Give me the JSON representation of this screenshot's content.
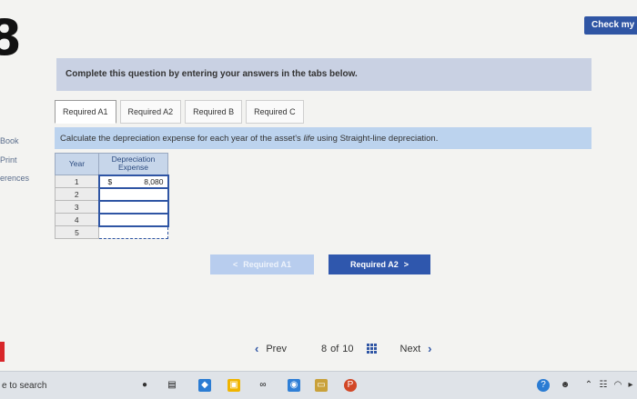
{
  "header": {
    "check_label": "Check my",
    "question_number": "8"
  },
  "sidebar": {
    "items": [
      "Book",
      "Print",
      "erences"
    ]
  },
  "banner": {
    "text": "Complete this question by entering your answers in the tabs below."
  },
  "tabs": [
    {
      "label": "Required A1",
      "active": true
    },
    {
      "label": "Required A2",
      "active": false
    },
    {
      "label": "Required B",
      "active": false
    },
    {
      "label": "Required C",
      "active": false
    }
  ],
  "instruction": {
    "pre": "Calculate the depreciation expense for each year of the asset's ",
    "italic": "life",
    "post": " using Straight-line depreciation."
  },
  "table": {
    "col_year": "Year",
    "col_expense": "Depreciation Expense",
    "rows": [
      {
        "year": "1",
        "currency": "$",
        "value": "8,080"
      },
      {
        "year": "2",
        "currency": "",
        "value": ""
      },
      {
        "year": "3",
        "currency": "",
        "value": ""
      },
      {
        "year": "4",
        "currency": "",
        "value": ""
      },
      {
        "year": "5",
        "currency": "",
        "value": ""
      }
    ]
  },
  "nav": {
    "prev_label": "Required A1",
    "next_label": "Required A2"
  },
  "pager": {
    "prev": "Prev",
    "current": "8",
    "of": "of",
    "total": "10",
    "next": "Next"
  },
  "taskbar": {
    "search_text": "e to search"
  },
  "colors": {
    "accent": "#2f55a4",
    "banner": "#c9d1e3",
    "instruction_bg": "#bcd3ee"
  }
}
